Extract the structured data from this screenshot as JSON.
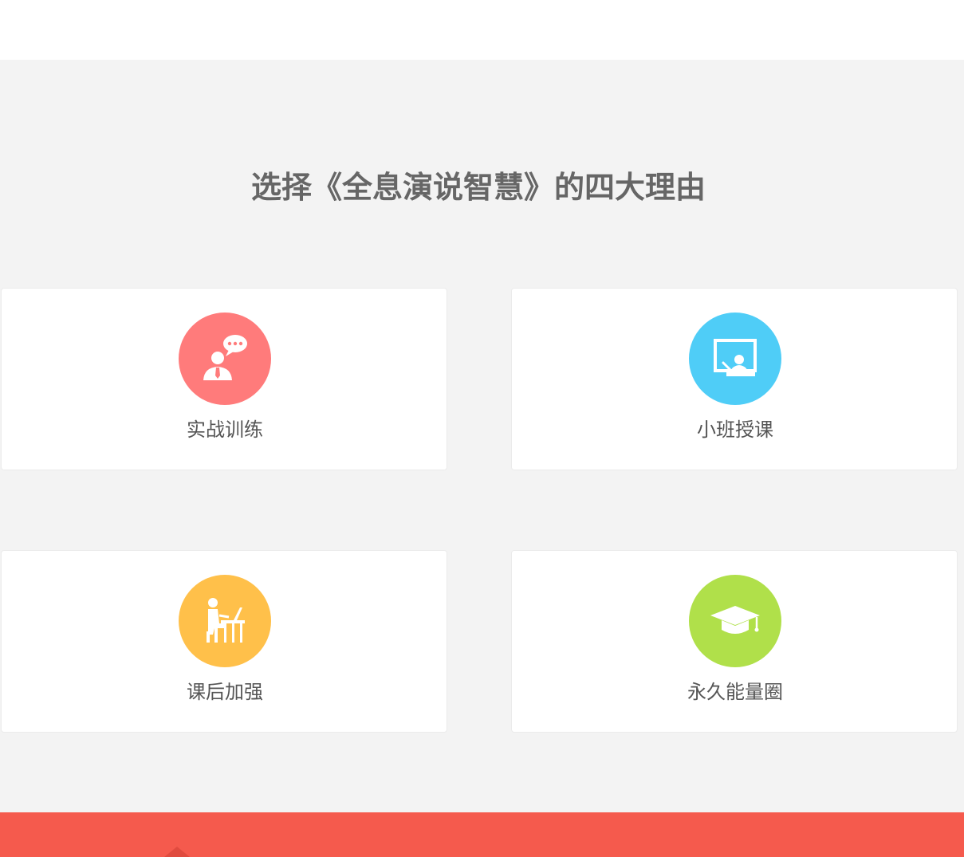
{
  "section": {
    "title": "选择《全息演说智慧》的四大理由"
  },
  "reasons": [
    {
      "label": "实战训练",
      "icon": "speaker-speech-bubble-icon",
      "color": "#ff7b7b"
    },
    {
      "label": "小班授课",
      "icon": "presenter-screen-icon",
      "color": "#4fcdf7"
    },
    {
      "label": "课后加强",
      "icon": "person-at-desk-icon",
      "color": "#ffc04a"
    },
    {
      "label": "永久能量圈",
      "icon": "graduation-cap-icon",
      "color": "#b0e04a"
    }
  ],
  "colors": {
    "section_background": "#f3f3f3",
    "footer_band": "#f55a4d",
    "title_text": "#666666"
  }
}
